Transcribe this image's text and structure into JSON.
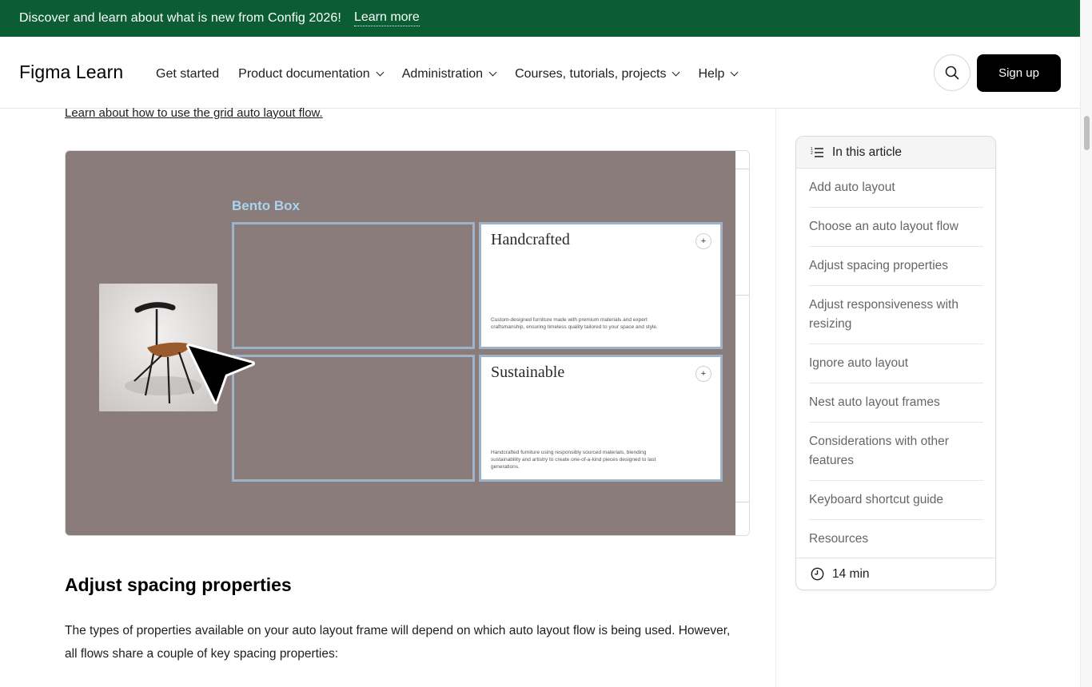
{
  "banner": {
    "message": "Discover and learn about what is new from Config 2026!",
    "link": "Learn more"
  },
  "header": {
    "logo": "Figma Learn",
    "nav": [
      {
        "label": "Get started",
        "has_dropdown": false
      },
      {
        "label": "Product documentation",
        "has_dropdown": true
      },
      {
        "label": "Administration",
        "has_dropdown": true
      },
      {
        "label": "Courses, tutorials, projects",
        "has_dropdown": true
      },
      {
        "label": "Help",
        "has_dropdown": true
      }
    ],
    "search_icon": "search-icon",
    "signup_label": "Sign up"
  },
  "content": {
    "grid_link": "Learn about how to use the grid auto layout flow.",
    "figure": {
      "title": "Bento Box",
      "cards": [
        {
          "title": "Handcrafted",
          "plus": "+",
          "text": "Custom-designed furniture made with premium materials and expert craftsmanship, ensuring timeless quality tailored to your space and style."
        },
        {
          "title": "Sustainable",
          "plus": "+",
          "text": "Handcrafted furniture using responsibly sourced materials, blending sustainability and artistry to create one-of-a-kind pieces designed to last generations."
        }
      ]
    },
    "section_heading": "Adjust spacing properties",
    "paragraph": "The types of properties available on your auto layout frame will depend on which auto layout flow is being used. However, all flows share a couple of key spacing properties:"
  },
  "toc": {
    "title": "In this article",
    "items": [
      "Add auto layout",
      "Choose an auto layout flow",
      "Adjust spacing properties",
      "Adjust responsiveness with resizing",
      "Ignore auto layout",
      "Nest auto layout frames",
      "Considerations with other features",
      "Keyboard shortcut guide",
      "Resources"
    ],
    "read_time": "14 min"
  },
  "colors": {
    "banner_bg": "#0b5d34",
    "figure_bg": "#8a7c7a",
    "cell_border": "#9fb3c8",
    "bento_title": "#a9d3ef"
  }
}
